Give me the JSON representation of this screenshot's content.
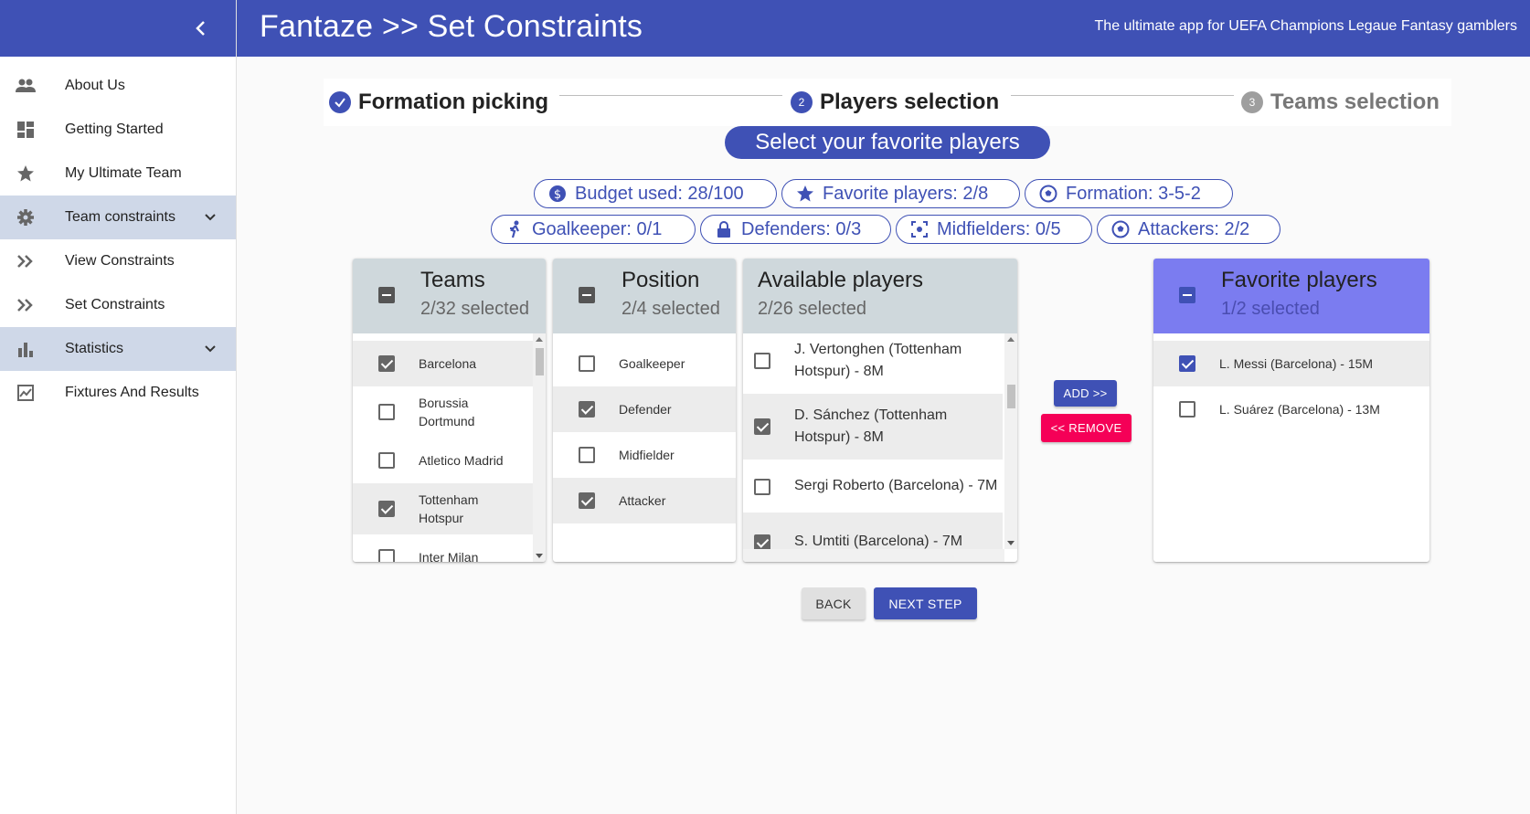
{
  "app": {
    "title": "Fantaze >> Set Constraints",
    "subtitle": "The ultimate app for UEFA Champions Legaue Fantasy gamblers"
  },
  "sidebar": {
    "items": [
      {
        "label": "About Us",
        "icon": "people-icon"
      },
      {
        "label": "Getting Started",
        "icon": "dashboard-icon"
      },
      {
        "label": "My Ultimate Team",
        "icon": "star-icon"
      },
      {
        "label": "Team constraints",
        "icon": "gear-icon",
        "expandable": true
      },
      {
        "label": "View Constraints",
        "icon": "double-chevron-icon"
      },
      {
        "label": "Set Constraints",
        "icon": "double-chevron-icon"
      },
      {
        "label": "Statistics",
        "icon": "bar-chart-icon",
        "expandable": true
      },
      {
        "label": "Fixtures And Results",
        "icon": "scoreboard-icon"
      }
    ]
  },
  "stepper": {
    "steps": [
      {
        "label": "Formation picking",
        "number": "",
        "state": "completed"
      },
      {
        "label": "Players selection",
        "number": "2",
        "state": "active"
      },
      {
        "label": "Teams selection",
        "number": "3",
        "state": "pending"
      }
    ]
  },
  "headline": "Select your favorite players",
  "chips": {
    "budget": "Budget used: 28/100",
    "favorites": "Favorite players: 2/8",
    "formation": "Formation: 3-5-2",
    "goalkeeper": "Goalkeeper: 0/1",
    "defenders": "Defenders: 0/3",
    "midfielders": "Midfielders: 0/5",
    "attackers": "Attackers: 2/2"
  },
  "teams": {
    "title": "Teams",
    "subtitle": "2/32 selected",
    "items": [
      {
        "label": "Barcelona",
        "checked": true
      },
      {
        "label": "Borussia Dortmund",
        "checked": false
      },
      {
        "label": "Atletico Madrid",
        "checked": false
      },
      {
        "label": "Tottenham Hotspur",
        "checked": true
      },
      {
        "label": "Inter Milan",
        "checked": false
      }
    ]
  },
  "positions": {
    "title": "Position",
    "subtitle": "2/4 selected",
    "items": [
      {
        "label": "Goalkeeper",
        "checked": false
      },
      {
        "label": "Defender",
        "checked": true
      },
      {
        "label": "Midfielder",
        "checked": false
      },
      {
        "label": "Attacker",
        "checked": true
      }
    ]
  },
  "available": {
    "title": "Available players",
    "subtitle": "2/26 selected",
    "items": [
      {
        "label": "J. Vertonghen (Tottenham Hotspur) - 8M",
        "checked": false
      },
      {
        "label": "D. Sánchez (Tottenham Hotspur) - 8M",
        "checked": true
      },
      {
        "label": "Sergi Roberto (Barcelona) - 7M",
        "checked": false
      },
      {
        "label": "S. Umtiti (Barcelona) - 7M",
        "checked": true
      }
    ]
  },
  "favorites": {
    "title": "Favorite players",
    "subtitle": "1/2 selected",
    "items": [
      {
        "label": "L. Messi (Barcelona) - 15M",
        "checked": true
      },
      {
        "label": "L. Suárez (Barcelona) - 13M",
        "checked": false
      }
    ]
  },
  "buttons": {
    "add": "ADD >>",
    "remove": "<< REMOVE",
    "back": "BACK",
    "next": "NEXT STEP"
  },
  "colors": {
    "primary": "#3f51b5",
    "accent": "#f50057",
    "favorites_header": "#7b7cf0",
    "list_header": "#cfd8dc"
  }
}
